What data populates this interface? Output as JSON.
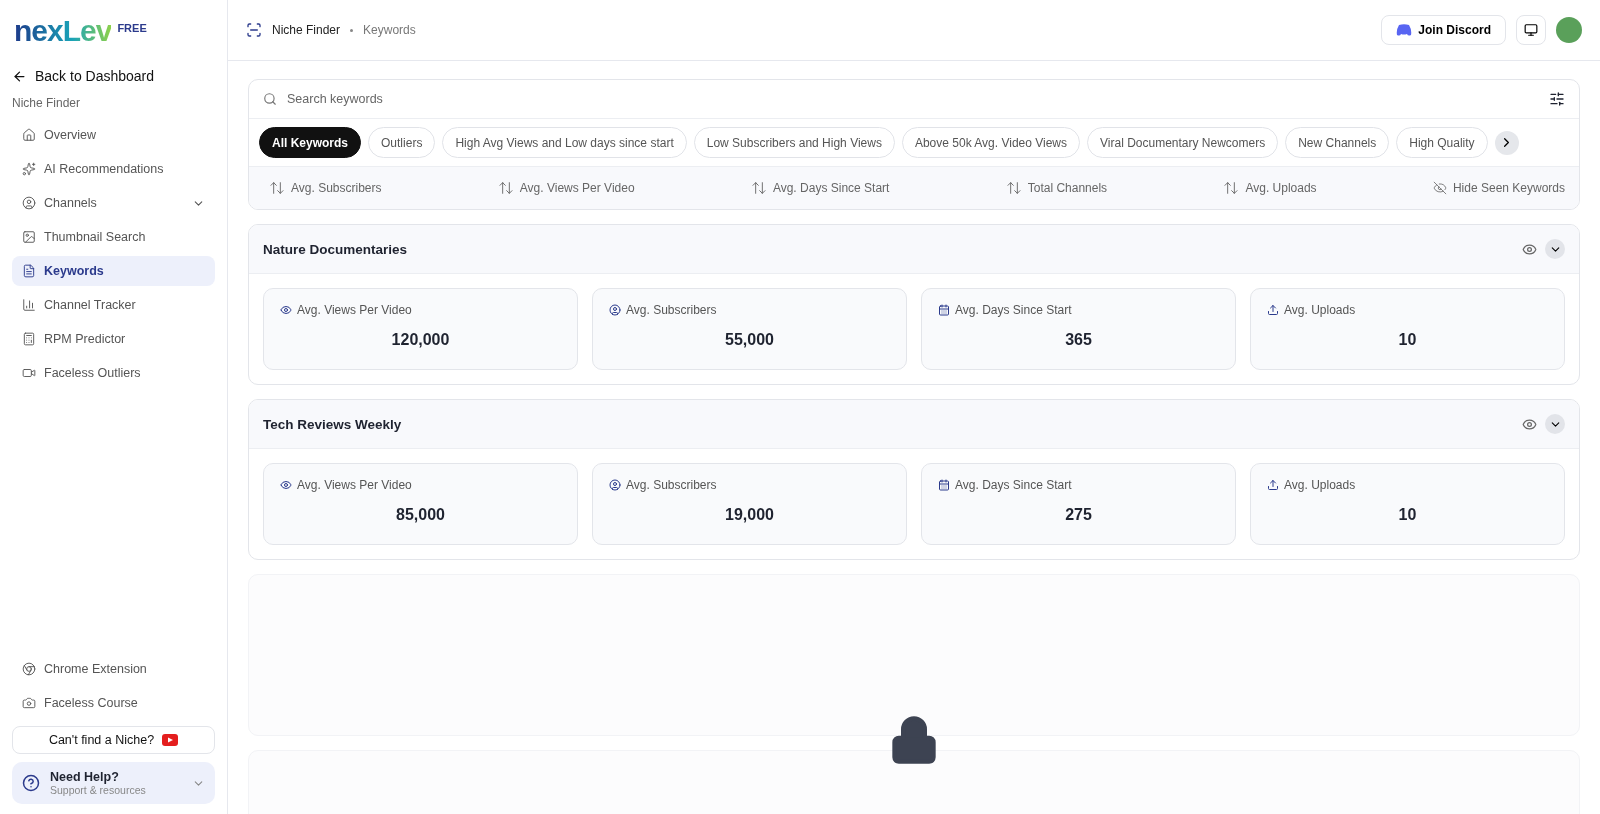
{
  "sidebar": {
    "logo": "nexLev",
    "plan": "FREE",
    "back": "Back to Dashboard",
    "section": "Niche Finder",
    "items": [
      {
        "label": "Overview",
        "selected": false,
        "expandable": false
      },
      {
        "label": "AI Recommendations",
        "selected": false,
        "expandable": false
      },
      {
        "label": "Channels",
        "selected": false,
        "expandable": true
      },
      {
        "label": "Thumbnail Search",
        "selected": false,
        "expandable": false
      },
      {
        "label": "Keywords",
        "selected": true,
        "expandable": false
      },
      {
        "label": "Channel Tracker",
        "selected": false,
        "expandable": false
      },
      {
        "label": "RPM Predictor",
        "selected": false,
        "expandable": false
      },
      {
        "label": "Faceless Outliers",
        "selected": false,
        "expandable": false
      }
    ],
    "bottom_links": [
      {
        "label": "Chrome Extension"
      },
      {
        "label": "Faceless Course"
      }
    ],
    "niche_button": "Can't find a Niche?",
    "help": {
      "title": "Need Help?",
      "subtitle": "Support & resources"
    }
  },
  "header": {
    "breadcrumb": [
      "Niche Finder",
      "Keywords"
    ],
    "discord": "Join Discord"
  },
  "search": {
    "placeholder": "Search keywords"
  },
  "filters": [
    {
      "label": "All Keywords",
      "selected": true
    },
    {
      "label": "Outliers",
      "selected": false
    },
    {
      "label": "High Avg Views and Low days since start",
      "selected": false
    },
    {
      "label": "Low Subscribers and High Views",
      "selected": false
    },
    {
      "label": "Above 50k Avg. Video Views",
      "selected": false
    },
    {
      "label": "Viral Documentary Newcomers",
      "selected": false
    },
    {
      "label": "New Channels",
      "selected": false
    },
    {
      "label": "High Quality",
      "selected": false
    }
  ],
  "sorts": [
    "Avg. Subscribers",
    "Avg. Views Per Video",
    "Avg. Days Since Start",
    "Total Channels",
    "Avg. Uploads"
  ],
  "hide_seen": "Hide Seen Keywords",
  "niches": [
    {
      "title": "Nature Documentaries",
      "stats": [
        {
          "kind": "views",
          "label": "Avg. Views Per Video",
          "value": "120,000"
        },
        {
          "kind": "subs",
          "label": "Avg. Subscribers",
          "value": "55,000"
        },
        {
          "kind": "days",
          "label": "Avg. Days Since Start",
          "value": "365"
        },
        {
          "kind": "uploads",
          "label": "Avg. Uploads",
          "value": "10"
        }
      ]
    },
    {
      "title": "Tech Reviews Weekly",
      "stats": [
        {
          "kind": "views",
          "label": "Avg. Views Per Video",
          "value": "85,000"
        },
        {
          "kind": "subs",
          "label": "Avg. Subscribers",
          "value": "19,000"
        },
        {
          "kind": "days",
          "label": "Avg. Days Since Start",
          "value": "275"
        },
        {
          "kind": "uploads",
          "label": "Avg. Uploads",
          "value": "10"
        }
      ]
    }
  ]
}
